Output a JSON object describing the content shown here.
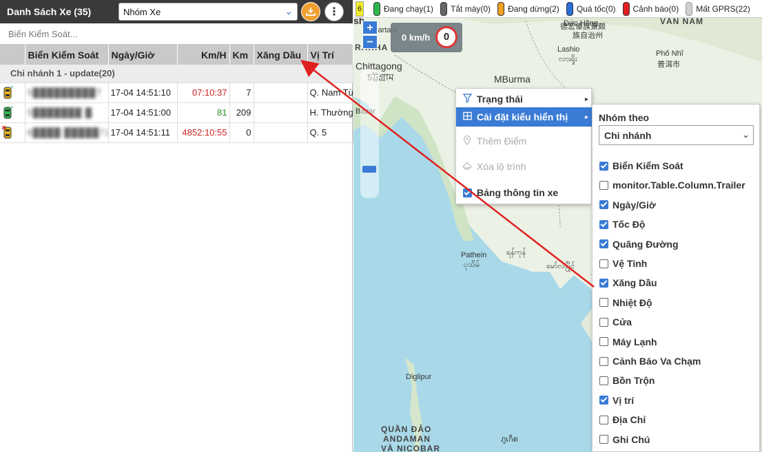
{
  "panel": {
    "title": "Danh Sách Xe (35)",
    "group_select": "Nhóm Xe",
    "search_placeholder": "Biển Kiểm Soát..."
  },
  "table": {
    "columns": [
      "Biển Kiểm Soát",
      "Ngày/Giờ",
      "Km/H",
      "Km",
      "Xăng Dầu",
      "Vị Trí"
    ],
    "group_label": "Chi nhánh 1 - update(20)",
    "rows": [
      {
        "plate": "5█████████T",
        "time": "17-04 14:51:10",
        "kmh": "07:10:37",
        "km": "7",
        "fuel": "",
        "location": "Q. Nam Từ",
        "kmh_color": "#cc2222"
      },
      {
        "plate": "5███████ █",
        "time": "17-04 14:51:00",
        "kmh": "81",
        "km": "209",
        "fuel": "",
        "location": "H. Thường",
        "kmh_color": "#2a8a2a"
      },
      {
        "plate": "8████ █████71",
        "time": "17-04 14:51:11",
        "kmh": "4852:10:55",
        "km": "0",
        "fuel": "",
        "location": "Q. 5",
        "kmh_color": "#cc2222"
      }
    ]
  },
  "status_bar": {
    "badge": "6",
    "items": [
      {
        "label": "Đang chạy(1)",
        "color": "#2db84d"
      },
      {
        "label": "Tắt máy(0)",
        "color": "#666666"
      },
      {
        "label": "Đang dừng(2)",
        "color": "#f0a020"
      },
      {
        "label": "Quá tốc(0)",
        "color": "#2a6fd6"
      },
      {
        "label": "Cảnh báo(0)",
        "color": "#e02020"
      },
      {
        "label": "Mất GPRS(22)",
        "color": "#d0d0d0"
      }
    ]
  },
  "map": {
    "zoom_in": "+",
    "zoom_out": "−",
    "speed": "0 km/h",
    "speed_limit": "0",
    "labels": {
      "chittagong": "Chittagong",
      "chittagong_bn": "চট্টগ্রাম",
      "burma": "MBurma",
      "pathein": "Pathein",
      "pathein_my": "ပုသိမ်",
      "yangon_my": "ရန်ကုန်",
      "mawlamyine_my": "မော်လမြိုင်",
      "diglipur": "Diglipur",
      "andaman1": "QUẦN ĐẢO",
      "andaman2": "ANDAMAN",
      "andaman3": "VÀ NICOBAR",
      "lashio": "Lashio",
      "lashio_my": "လားရှိုး",
      "dehong": "德宏傣族景颇",
      "dehong2": "族自治州",
      "dehong_vi": "Đức Hồng",
      "phonhi": "Phố Nhĩ",
      "phonhi_cn": "普洱市",
      "vannan": "VÂN NAM",
      "rakhine": "RAKHA",
      "bazar": "Bazar",
      "khartala": "Khartala",
      "phuket_th": "ภูเก็ต",
      "s_char": "sh"
    }
  },
  "context_menu": {
    "items": [
      {
        "label": "Trạng thái",
        "icon": "filter-icon"
      },
      {
        "label": "Cài đặt kiểu hiển thị",
        "icon": "grid-icon"
      },
      {
        "label": "Thêm Điểm",
        "icon": "pin-icon"
      },
      {
        "label": "Xóa lộ trình",
        "icon": "eraser-icon"
      },
      {
        "label": "Bảng thông tin xe",
        "icon": "checkbox-icon"
      }
    ]
  },
  "submenu": {
    "group_by_label": "Nhóm theo",
    "group_by_value": "Chi nhánh",
    "columns": [
      {
        "label": "Biển Kiểm Soát",
        "checked": true
      },
      {
        "label": "monitor.Table.Column.Trailer",
        "checked": false
      },
      {
        "label": "Ngày/Giờ",
        "checked": true
      },
      {
        "label": "Tốc Độ",
        "checked": true
      },
      {
        "label": "Quãng Đường",
        "checked": true
      },
      {
        "label": "Vệ Tinh",
        "checked": false
      },
      {
        "label": "Xăng Dầu",
        "checked": true
      },
      {
        "label": "Nhiệt Độ",
        "checked": false
      },
      {
        "label": "Cửa",
        "checked": false
      },
      {
        "label": "Máy Lạnh",
        "checked": false
      },
      {
        "label": "Cảnh Báo Va Chạm",
        "checked": false
      },
      {
        "label": "Bồn Trộn",
        "checked": false
      },
      {
        "label": "Vị trí",
        "checked": true
      },
      {
        "label": "Địa Chỉ",
        "checked": false
      },
      {
        "label": "Ghi Chú",
        "checked": false
      }
    ]
  }
}
